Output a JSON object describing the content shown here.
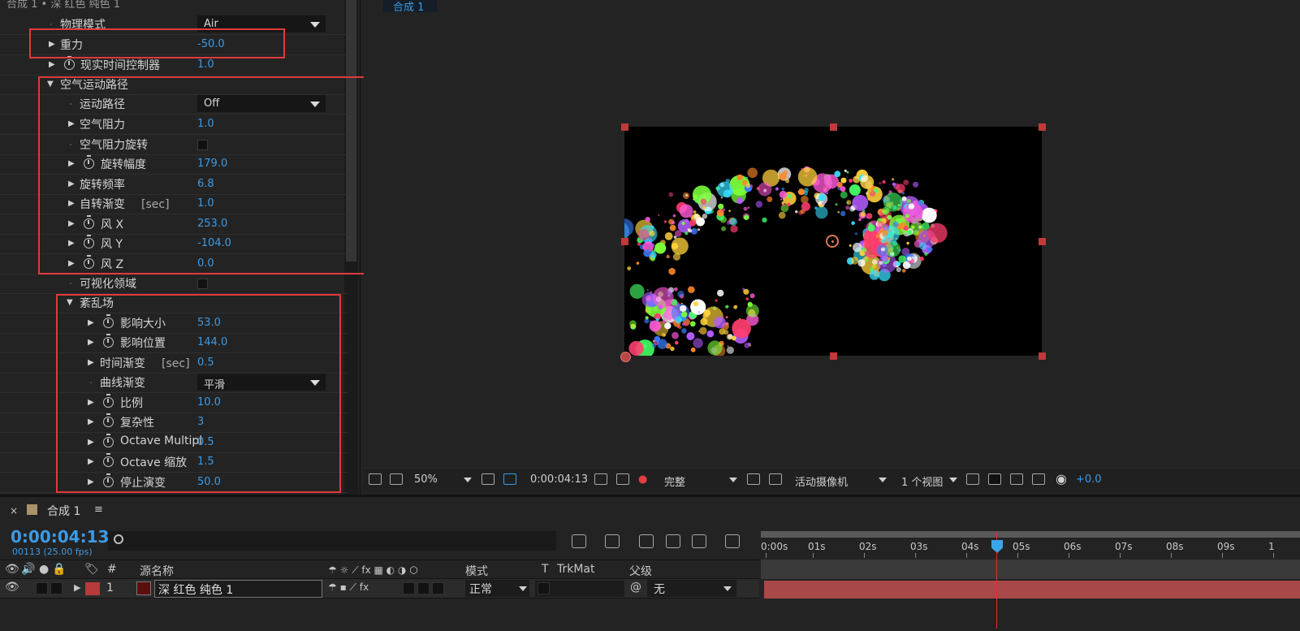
{
  "effects_panel": {
    "title": "合成 1 • 深 红色 纯色 1",
    "rows": [
      {
        "label": "物理模式",
        "dropdown": "Air"
      },
      {
        "label": "重力",
        "value": "-50.0"
      },
      {
        "label": "现实时间控制器",
        "value": "1.0"
      },
      {
        "label": "空气运动路径"
      },
      {
        "label": "运动路径",
        "dropdown": "Off"
      },
      {
        "label": "空气阻力",
        "value": "1.0"
      },
      {
        "label": "空气阻力旋转"
      },
      {
        "label": "旋转幅度",
        "value": "179.0"
      },
      {
        "label": "旋转频率",
        "value": "6.8"
      },
      {
        "label": "自转渐变",
        "unit": "[sec]",
        "value": "1.0"
      },
      {
        "label": "风   X",
        "value": "253.0"
      },
      {
        "label": "风   Y",
        "value": "-104.0"
      },
      {
        "label": "风   Z",
        "value": "0.0"
      },
      {
        "label": "可视化领域"
      },
      {
        "label": "紊乱场"
      },
      {
        "label": "影响大小",
        "value": "53.0"
      },
      {
        "label": "影响位置",
        "value": "144.0"
      },
      {
        "label": "时间渐变",
        "unit": "[sec]",
        "value": "0.5"
      },
      {
        "label": "曲线渐变",
        "dropdown": "平滑"
      },
      {
        "label": "比例",
        "value": "10.0"
      },
      {
        "label": "复杂性",
        "value": "3"
      },
      {
        "label": "Octave Multipl",
        "value": "0.5"
      },
      {
        "label": "Octave 缩放",
        "value": "1.5"
      },
      {
        "label": "停止演变",
        "value": "50.0"
      }
    ]
  },
  "viewer": {
    "tab": "合成 1",
    "zoom": "50%",
    "timecode": "0:00:04:13",
    "resolution": "完整",
    "camera": "活动摄像机",
    "views": "1 个视图",
    "exposure": "+0.0"
  },
  "timeline": {
    "close": "×",
    "tab": "合成 1",
    "menu": "≡",
    "current_time": "0:00:04:13",
    "frame_info": "00113 (25.00 fps)",
    "ruler_labels": [
      "0:00s",
      "01s",
      "02s",
      "03s",
      "04s",
      "05s",
      "06s",
      "07s",
      "08s",
      "09s",
      "1"
    ],
    "columns": {
      "num": "#",
      "source_name": "源名称",
      "mode": "模式",
      "t": "T",
      "trkmat": "TrkMat",
      "parent": "父级"
    },
    "layer": {
      "number": "1",
      "name": "深 红色 纯色 1",
      "mode": "正常",
      "parent": "无",
      "color": "#b93a3a"
    }
  },
  "colors": {
    "accent": "#3d9ae4",
    "highlight_box": "#e13a3a",
    "playhead": "#e03030",
    "layer_bar": "#a84848"
  }
}
